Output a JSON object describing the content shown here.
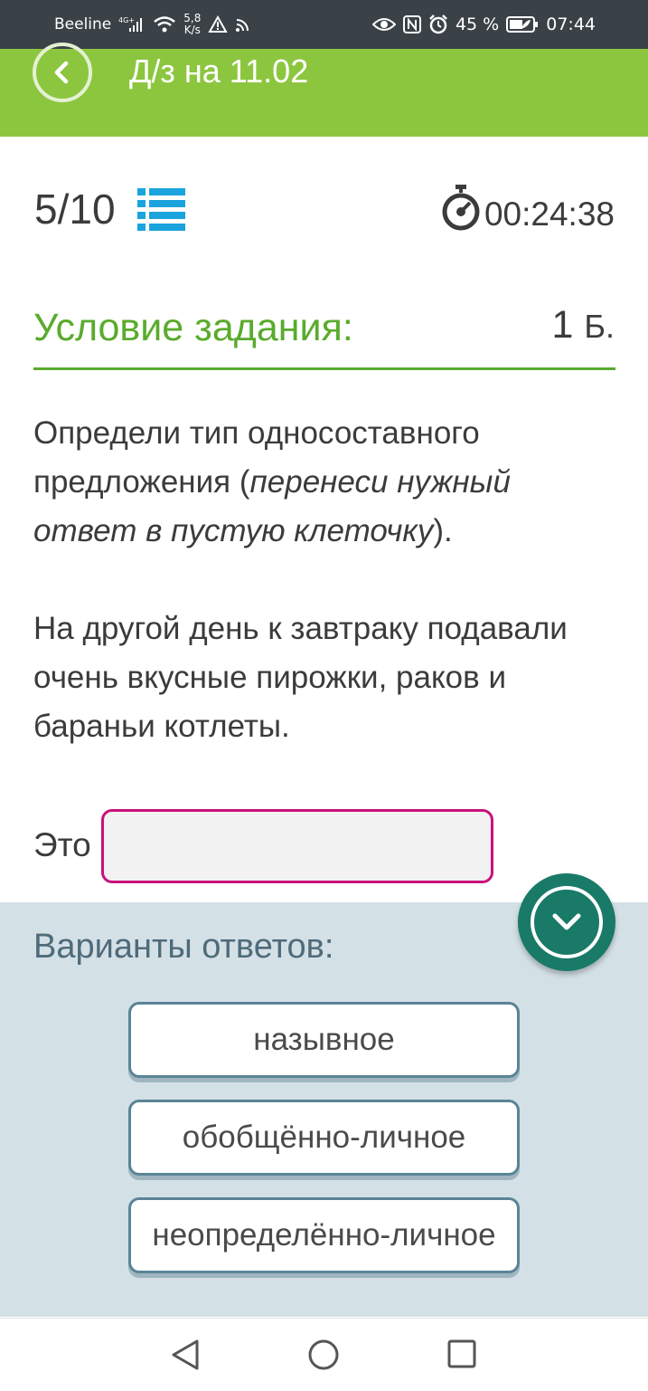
{
  "status_bar": {
    "carrier": "Beeline",
    "network_type": "4G+",
    "speed_value": "5,8",
    "speed_unit": "K/s",
    "battery": "45 %",
    "time": "07:44"
  },
  "header": {
    "title": "Д/з на 11.02"
  },
  "progress": {
    "counter": "5/10",
    "timer": "00:24:38"
  },
  "condition": {
    "title": "Условие задания:",
    "points_value": "1",
    "points_unit": "Б."
  },
  "task": {
    "instruction_start": "Определи тип односоставного предложения (",
    "instruction_italic": "перенеси нужный ответ в пустую клеточку",
    "instruction_end": ").",
    "sentence": "На другой день к завтраку подавали очень вкусные пирожки, раков и бараньи котлеты.",
    "answer_prefix": "Это"
  },
  "options": {
    "title": "Варианты ответов:",
    "items": [
      {
        "label": "назывное"
      },
      {
        "label": "обобщённо-личное"
      },
      {
        "label": "неопределённо-личное"
      }
    ]
  },
  "colors": {
    "header_green": "#8cc63f",
    "accent_green": "#5aab2c",
    "slot_border": "#c8127c",
    "submit_teal": "#197a67",
    "list_icon_blue": "#1aa3dd"
  }
}
